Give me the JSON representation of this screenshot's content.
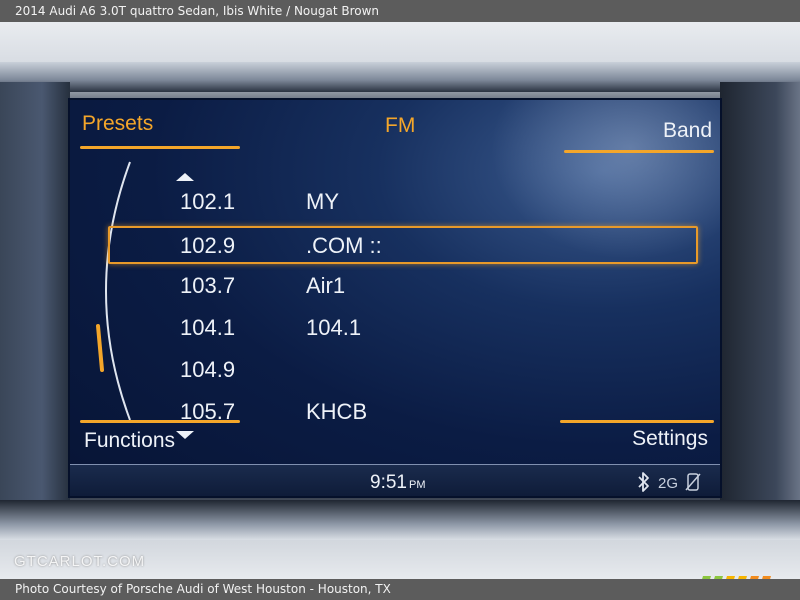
{
  "captions": {
    "top": "2014 Audi A6 3.0T quattro Sedan,  Ibis White / Nougat Brown",
    "bottom": "Photo Courtesy of Porsche Audi of West Houston - Houston, TX",
    "watermark": "GTCARLOT.COM"
  },
  "screen": {
    "presets_label": "Presets",
    "mode_label": "FM",
    "band_label": "Band",
    "functions_label": "Functions",
    "settings_label": "Settings",
    "stations": [
      {
        "freq": "102.1",
        "name": "MY",
        "selected": false
      },
      {
        "freq": "102.9",
        "name": ".COM ::",
        "selected": true
      },
      {
        "freq": "103.7",
        "name": "Air1",
        "selected": false
      },
      {
        "freq": "104.1",
        "name": "104.1",
        "selected": false
      },
      {
        "freq": "104.9",
        "name": "",
        "selected": false
      },
      {
        "freq": "105.7",
        "name": "KHCB",
        "selected": false
      }
    ],
    "status": {
      "time": "9:51",
      "ampm": "PM",
      "network": "2G",
      "icons": [
        "bluetooth-icon",
        "phone-icon"
      ]
    }
  },
  "colors": {
    "accent": "#f4a62a",
    "screen_bg": "#0b1c44",
    "text": "#eef2f8"
  }
}
